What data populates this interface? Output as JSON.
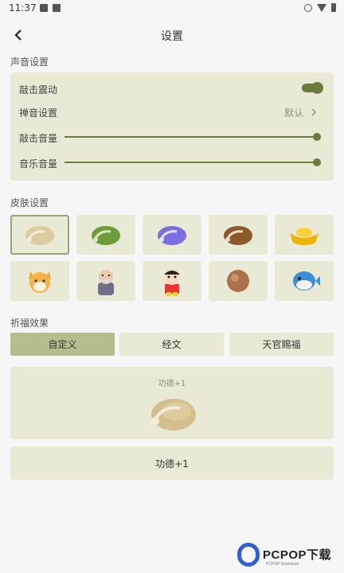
{
  "status_bar": {
    "time": "11:37"
  },
  "header": {
    "title": "设置"
  },
  "sound_section": {
    "title": "声音设置",
    "vibrate_label": "敲击震动",
    "vibrate_on": true,
    "zen_label": "禅音设置",
    "zen_value": "默认",
    "knock_volume_label": "敲击音量",
    "knock_volume": 1.0,
    "music_volume_label": "音乐音量",
    "music_volume": 1.0
  },
  "skin_section": {
    "title": "皮肤设置",
    "skins": [
      "wooden-fish-beige",
      "wooden-fish-green",
      "wooden-fish-purple",
      "wooden-fish-brown",
      "gold-ingot",
      "shiba-dog",
      "old-monk",
      "crayon-shin-chan",
      "round-wooden-fish",
      "pufferfish"
    ],
    "selected_index": 0
  },
  "blessing_section": {
    "title": "祈福效果",
    "tabs": [
      "自定义",
      "经文",
      "天官赐福"
    ],
    "active_tab": 0,
    "preview_text": "功德+1",
    "result_text": "功德+1"
  },
  "watermark": {
    "brand": "PCPOP下载",
    "sub": "PCPOP Download"
  },
  "colors": {
    "panel": "#e9ead6",
    "accent": "#6b7b3e",
    "tab_active": "#b4bd8c",
    "background": "#f6f6f6"
  }
}
